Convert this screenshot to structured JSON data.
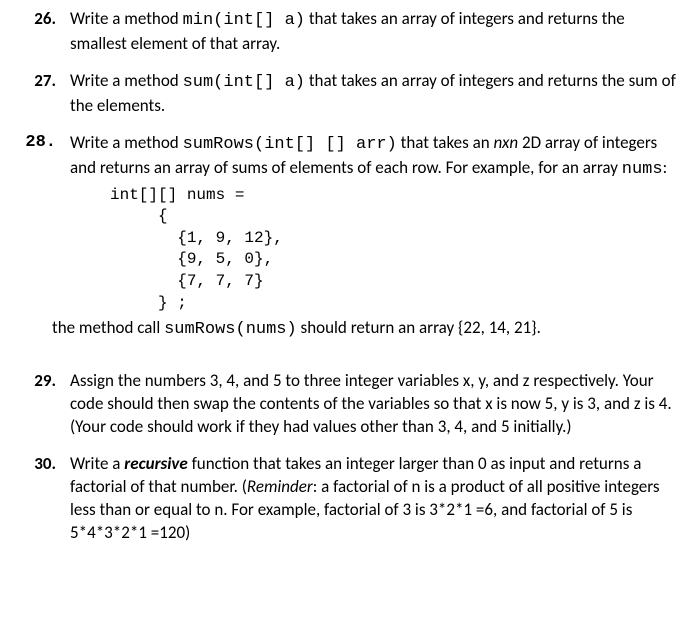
{
  "items": {
    "q26": {
      "num": "26.",
      "t1": "Write a method ",
      "code1": "min(int[] a)",
      "t2": " that takes an array of integers and returns the smallest element of that array."
    },
    "q27": {
      "num": "27.",
      "t1": "Write a method ",
      "code1": "sum(int[] a)",
      "t2": " that takes an array of integers and returns the sum of the elements."
    },
    "q28": {
      "num": "28.",
      "t1": "Write a method ",
      "code1": "sumRows(int[] [] arr)",
      "t2": " that takes an ",
      "nxn": "nxn",
      "t3": " 2D array of integers and returns an array of sums of elements of each row. For example, for an array ",
      "code2": "nums",
      "t4": ":",
      "block": "int[][] nums =\n     {\n       {1, 9, 12},\n       {9, 5, 0},\n       {7, 7, 7}\n     } ;",
      "t5": "the method call ",
      "code3": "sumRows(nums)",
      "t6": " should return an array {22, 14, 21}."
    },
    "q29": {
      "num": "29.",
      "t1": "Assign the numbers 3, 4, and 5 to three integer variables x, y, and z respectively. Your code should then swap the contents of the variables so that x is now 5, y is 3, and z is 4.  (Your code should work if they had values other than 3, 4, and 5 initially.)"
    },
    "q30": {
      "num": "30.",
      "t1": "Write a ",
      "rec": "recursive",
      "t2": " function that takes an integer larger than 0 as input and returns a factorial of that number. (",
      "rem": "Reminder",
      "t3": ": a factorial of n is a product of all positive integers less than or equal to n. For example, factorial of 3 is 3*2*1 =6, and factorial of 5 is 5*4*3*2*1 =120)"
    }
  }
}
